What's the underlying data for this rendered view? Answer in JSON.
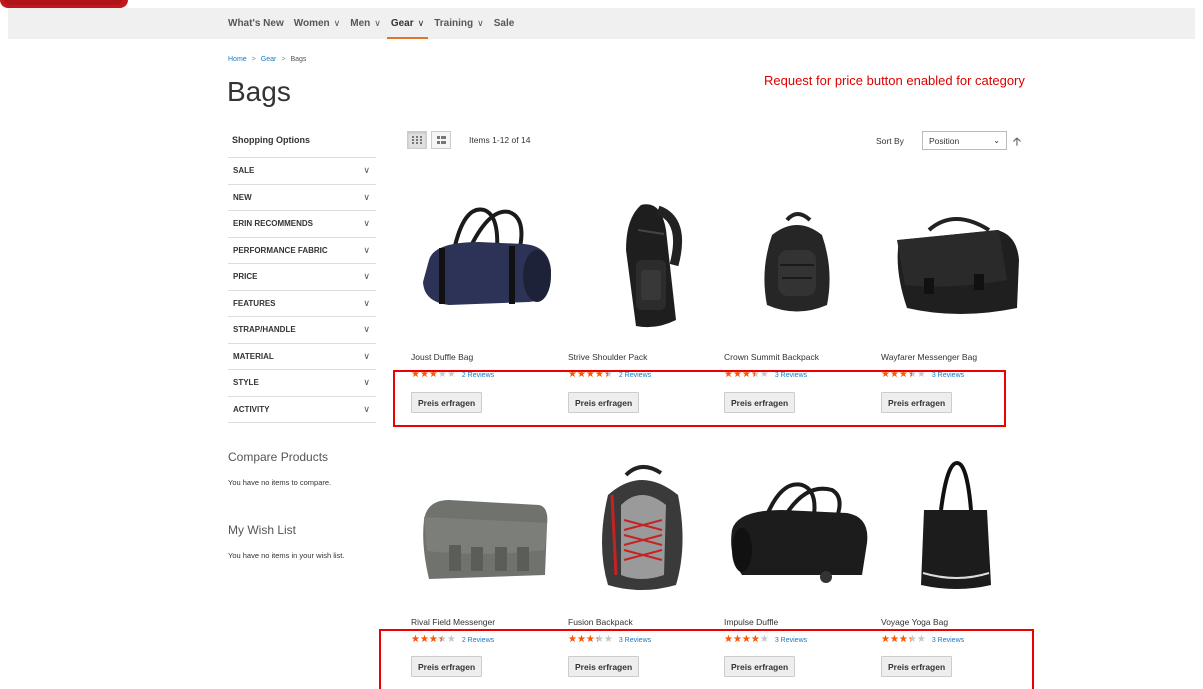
{
  "nav": {
    "items": [
      {
        "label": "What's New",
        "chevron": false,
        "active": false
      },
      {
        "label": "Women",
        "chevron": true,
        "active": false
      },
      {
        "label": "Men",
        "chevron": true,
        "active": false
      },
      {
        "label": "Gear",
        "chevron": true,
        "active": true
      },
      {
        "label": "Training",
        "chevron": true,
        "active": false
      },
      {
        "label": "Sale",
        "chevron": false,
        "active": false
      }
    ]
  },
  "breadcrumb": {
    "home": "Home",
    "gear": "Gear",
    "current": "Bags",
    "separator": ">"
  },
  "page_title": "Bags",
  "annotation": "Request for price button enabled for category",
  "sidebar": {
    "title": "Shopping Options",
    "filters": [
      "SALE",
      "NEW",
      "ERIN RECOMMENDS",
      "PERFORMANCE FABRIC",
      "PRICE",
      "FEATURES",
      "STRAP/HANDLE",
      "MATERIAL",
      "STYLE",
      "ACTIVITY"
    ],
    "compare_title": "Compare Products",
    "compare_text": "You have no items to compare.",
    "wishlist_title": "My Wish List",
    "wishlist_text": "You have no items in your wish list."
  },
  "toolbar": {
    "amount": "Items 1-12 of 14",
    "sort_label": "Sort By",
    "sort_value": "Position"
  },
  "button_label": "Preis erfragen",
  "products": [
    {
      "name": "Joust Duffle Bag",
      "rating_pct": 60,
      "reviews": "2 Reviews"
    },
    {
      "name": "Strive Shoulder Pack",
      "rating_pct": 90,
      "reviews": "2 Reviews"
    },
    {
      "name": "Crown Summit Backpack",
      "rating_pct": 70,
      "reviews": "3 Reviews"
    },
    {
      "name": "Wayfarer Messenger Bag",
      "rating_pct": 70,
      "reviews": "3 Reviews"
    },
    {
      "name": "Rival Field Messenger",
      "rating_pct": 70,
      "reviews": "2 Reviews"
    },
    {
      "name": "Fusion Backpack",
      "rating_pct": 67,
      "reviews": "3 Reviews"
    },
    {
      "name": "Impulse Duffle",
      "rating_pct": 80,
      "reviews": "3 Reviews"
    },
    {
      "name": "Voyage Yoga Bag",
      "rating_pct": 67,
      "reviews": "3 Reviews"
    }
  ],
  "colors": {
    "accent_orange": "#e67427",
    "star": "#ff5501",
    "link_blue": "#1979c3",
    "annotation_red": "#dd0000"
  }
}
